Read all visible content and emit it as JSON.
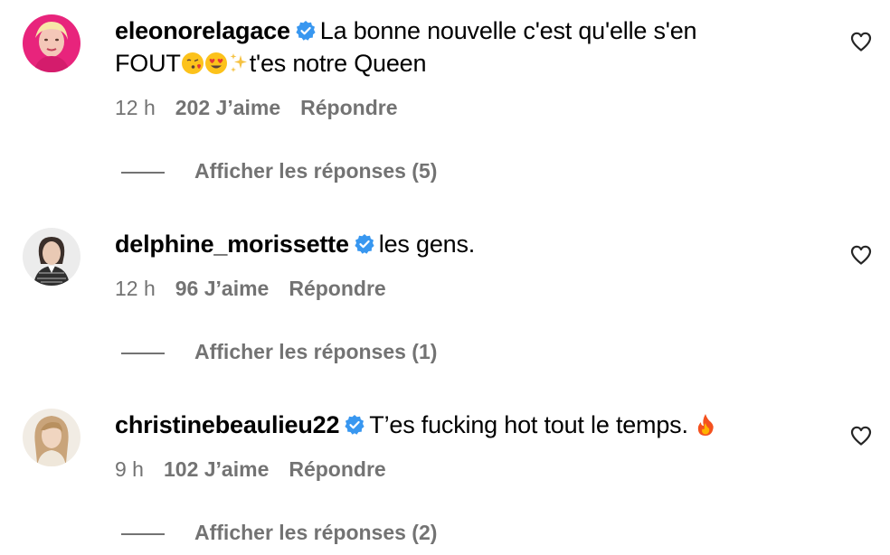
{
  "comments": [
    {
      "username": "eleonorelagace",
      "text_line1": "La bonne nouvelle c'est qu'elle s'en",
      "text_line2_start": "FOUT",
      "text_line2_end": "t'es notre Queen",
      "time": "12 h",
      "likes": "202 J’aime",
      "reply": "Répondre",
      "replies": "Afficher les réponses (5)",
      "avatar_color": "#e8247c"
    },
    {
      "username": "delphine_morissette",
      "text": "les gens.",
      "time": "12 h",
      "likes": "96 J’aime",
      "reply": "Répondre",
      "replies": "Afficher les réponses (1)"
    },
    {
      "username": "christinebeaulieu22",
      "text": "T’es fucking hot tout le temps.",
      "time": "9 h",
      "likes": "102 J’aime",
      "reply": "Répondre",
      "replies": "Afficher les réponses (2)"
    }
  ],
  "colors": {
    "verified": "#3897f0",
    "secondary_text": "#737373"
  },
  "icons": {
    "verified": "verified-badge-icon",
    "like": "heart-outline-icon"
  }
}
